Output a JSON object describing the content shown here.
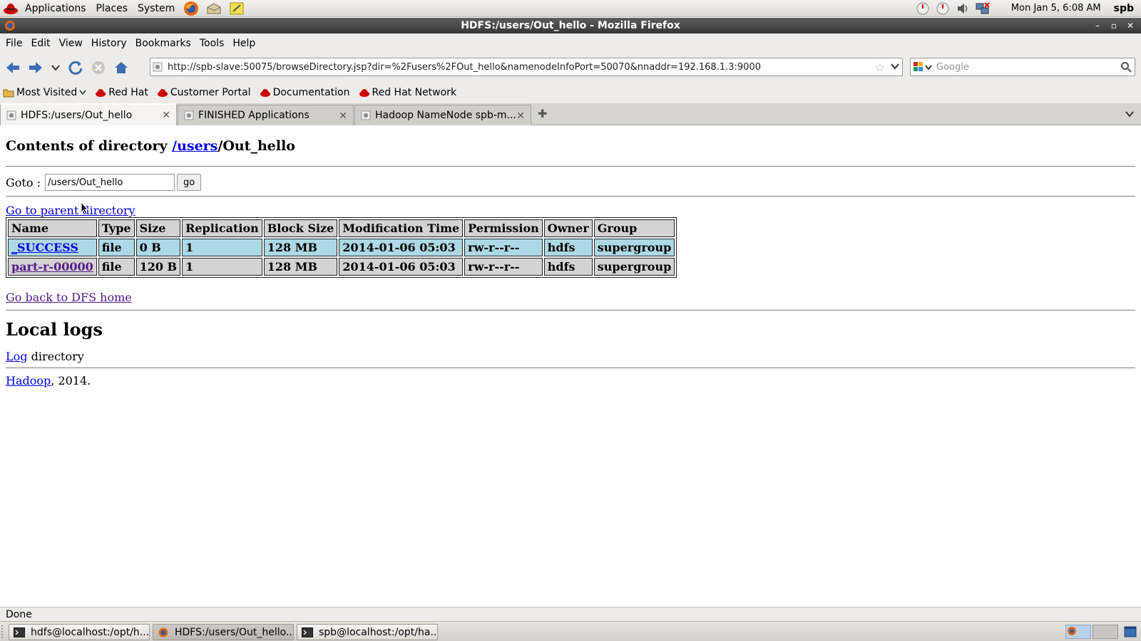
{
  "panel": {
    "menus": [
      "Applications",
      "Places",
      "System"
    ],
    "clock": "Mon Jan  5,  6:08 AM",
    "user": "spb"
  },
  "window": {
    "title": "HDFS:/users/Out_hello - Mozilla Firefox"
  },
  "menubar": [
    "File",
    "Edit",
    "View",
    "History",
    "Bookmarks",
    "Tools",
    "Help"
  ],
  "navbar": {
    "url": "http://spb-slave:50075/browseDirectory.jsp?dir=%2Fusers%2FOut_hello&namenodeInfoPort=50070&nnaddr=192.168.1.3:9000",
    "search_placeholder": "Google"
  },
  "bookmarks": [
    "Most Visited",
    "Red Hat",
    "Customer Portal",
    "Documentation",
    "Red Hat Network"
  ],
  "tabs": [
    {
      "label": "HDFS:/users/Out_hello"
    },
    {
      "label": "FINISHED Applications"
    },
    {
      "label": "Hadoop NameNode spb-m..."
    }
  ],
  "page": {
    "heading_prefix": "Contents of directory ",
    "heading_link": "/users",
    "heading_suffix": "/Out_hello",
    "goto_label": "Goto :",
    "goto_value": "/users/Out_hello",
    "go_label": "go",
    "parent_link": "Go to parent directory",
    "table": {
      "headers": [
        "Name",
        "Type",
        "Size",
        "Replication",
        "Block Size",
        "Modification Time",
        "Permission",
        "Owner",
        "Group"
      ],
      "rows": [
        [
          "_SUCCESS",
          "file",
          "0 B",
          "1",
          "128 MB",
          "2014-01-06 05:03",
          "rw-r--r--",
          "hdfs",
          "supergroup"
        ],
        [
          "part-r-00000",
          "file",
          "120 B",
          "1",
          "128 MB",
          "2014-01-06 05:03",
          "rw-r--r--",
          "hdfs",
          "supergroup"
        ]
      ]
    },
    "dfs_home_link": "Go back to DFS home",
    "local_logs_heading": "Local logs",
    "log_link": "Log",
    "log_suffix": " directory",
    "hadoop_link": "Hadoop",
    "hadoop_suffix": ", 2014."
  },
  "status": "Done",
  "taskbar": [
    {
      "label": "hdfs@localhost:/opt/h..."
    },
    {
      "label": "HDFS:/users/Out_hello..."
    },
    {
      "label": "spb@localhost:/opt/ha..."
    }
  ]
}
